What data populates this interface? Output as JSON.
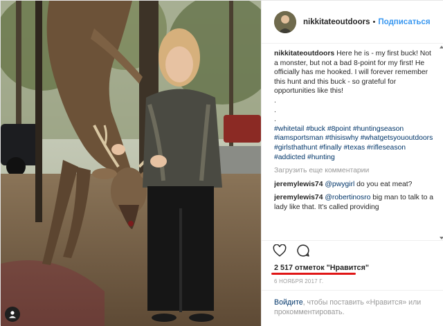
{
  "post": {
    "username": "nikkitateoutdoors",
    "separator": "•",
    "follow_label": "Подписаться",
    "caption_text": "Here he is - my first buck! Not a monster, but not a bad 8-point for my first! He officially has me hooked. I will forever remember this hunt and this buck - so grateful for opportunities like this!",
    "dots": [
      ".",
      ".",
      "."
    ],
    "hashtags": [
      "#whitetail",
      "#buck",
      "#8point",
      "#huntingseason",
      "#iamsportsman",
      "#thisiswhy",
      "#whatgetsyououtdoors",
      "#girlsthathunt",
      "#finally",
      "#texas",
      "#rifleseason",
      "#addicted",
      "#hunting"
    ],
    "load_more": "Загрузить еще комментарии",
    "comments": [
      {
        "user": "jeremylewis74",
        "mention": "@pwygirl",
        "text": "do you eat meat?"
      },
      {
        "user": "jeremylewis74",
        "mention": "@robertinosro",
        "text": "big man to talk to a lady like that. It's called providing"
      }
    ],
    "likes": "2 517 отметок \"Нравится\"",
    "date": "6 НОЯБРЯ 2017 Г.",
    "login_link": "Войдите",
    "login_text": ", чтобы поставить «Нравится» или прокомментировать."
  },
  "icons": {
    "like": "heart-icon",
    "comment": "comment-bubble-icon",
    "user": "user-tag-icon"
  },
  "colors": {
    "link": "#003569",
    "follow": "#3897f0",
    "underline": "#e01515",
    "muted": "#999999"
  }
}
